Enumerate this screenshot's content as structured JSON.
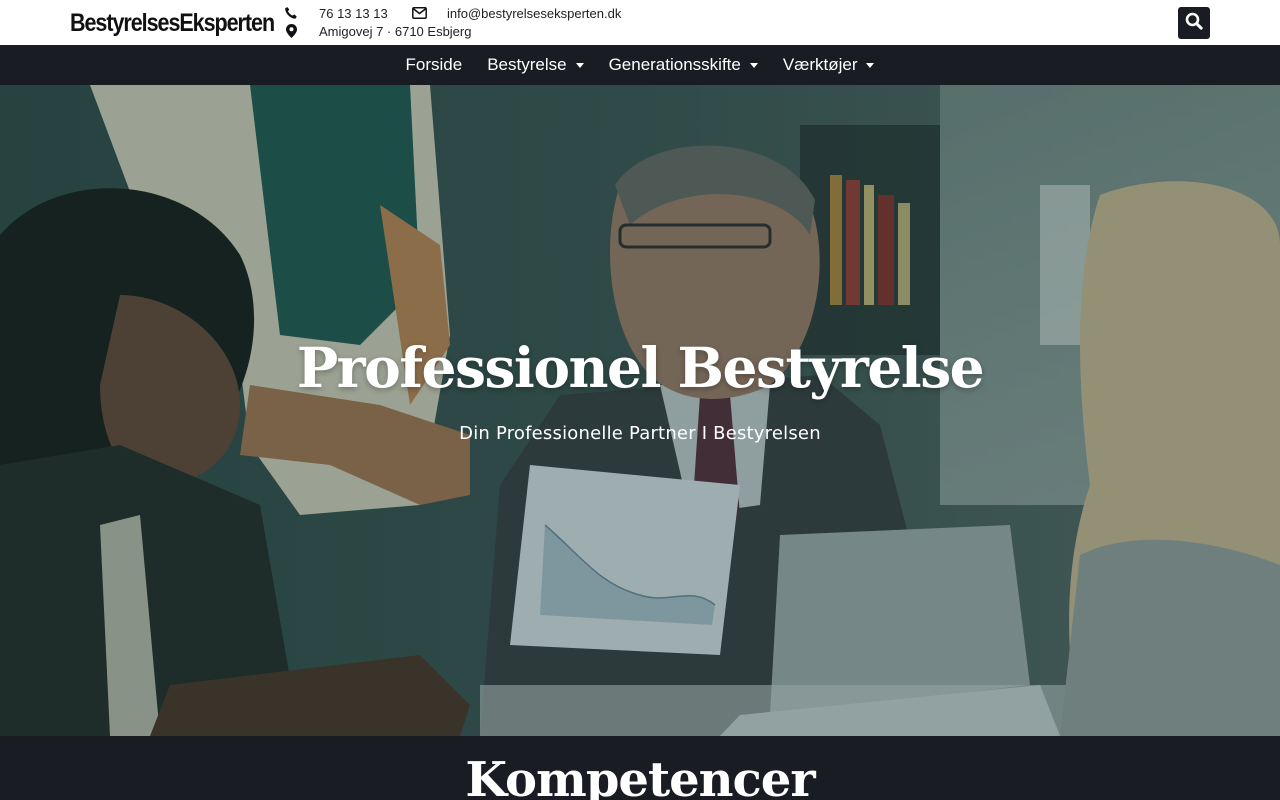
{
  "header": {
    "logo_text": "BestyrelsesEksperten",
    "phone": "76 13 13 13",
    "email": "info@bestyrelseseksperten.dk",
    "address": "Amigovej 7 · 6710 Esbjerg"
  },
  "nav": {
    "items": [
      {
        "label": "Forside"
      },
      {
        "label": "Bestyrelse"
      },
      {
        "label": "Generationsskifte"
      },
      {
        "label": "Værktøjer"
      }
    ]
  },
  "hero": {
    "title": "Professionel Bestyrelse",
    "subtitle": "Din Professionelle Partner I Bestyrelsen"
  },
  "section": {
    "title": "Kompetencer"
  },
  "colors": {
    "dark": "#1a1c24",
    "white": "#ffffff"
  }
}
